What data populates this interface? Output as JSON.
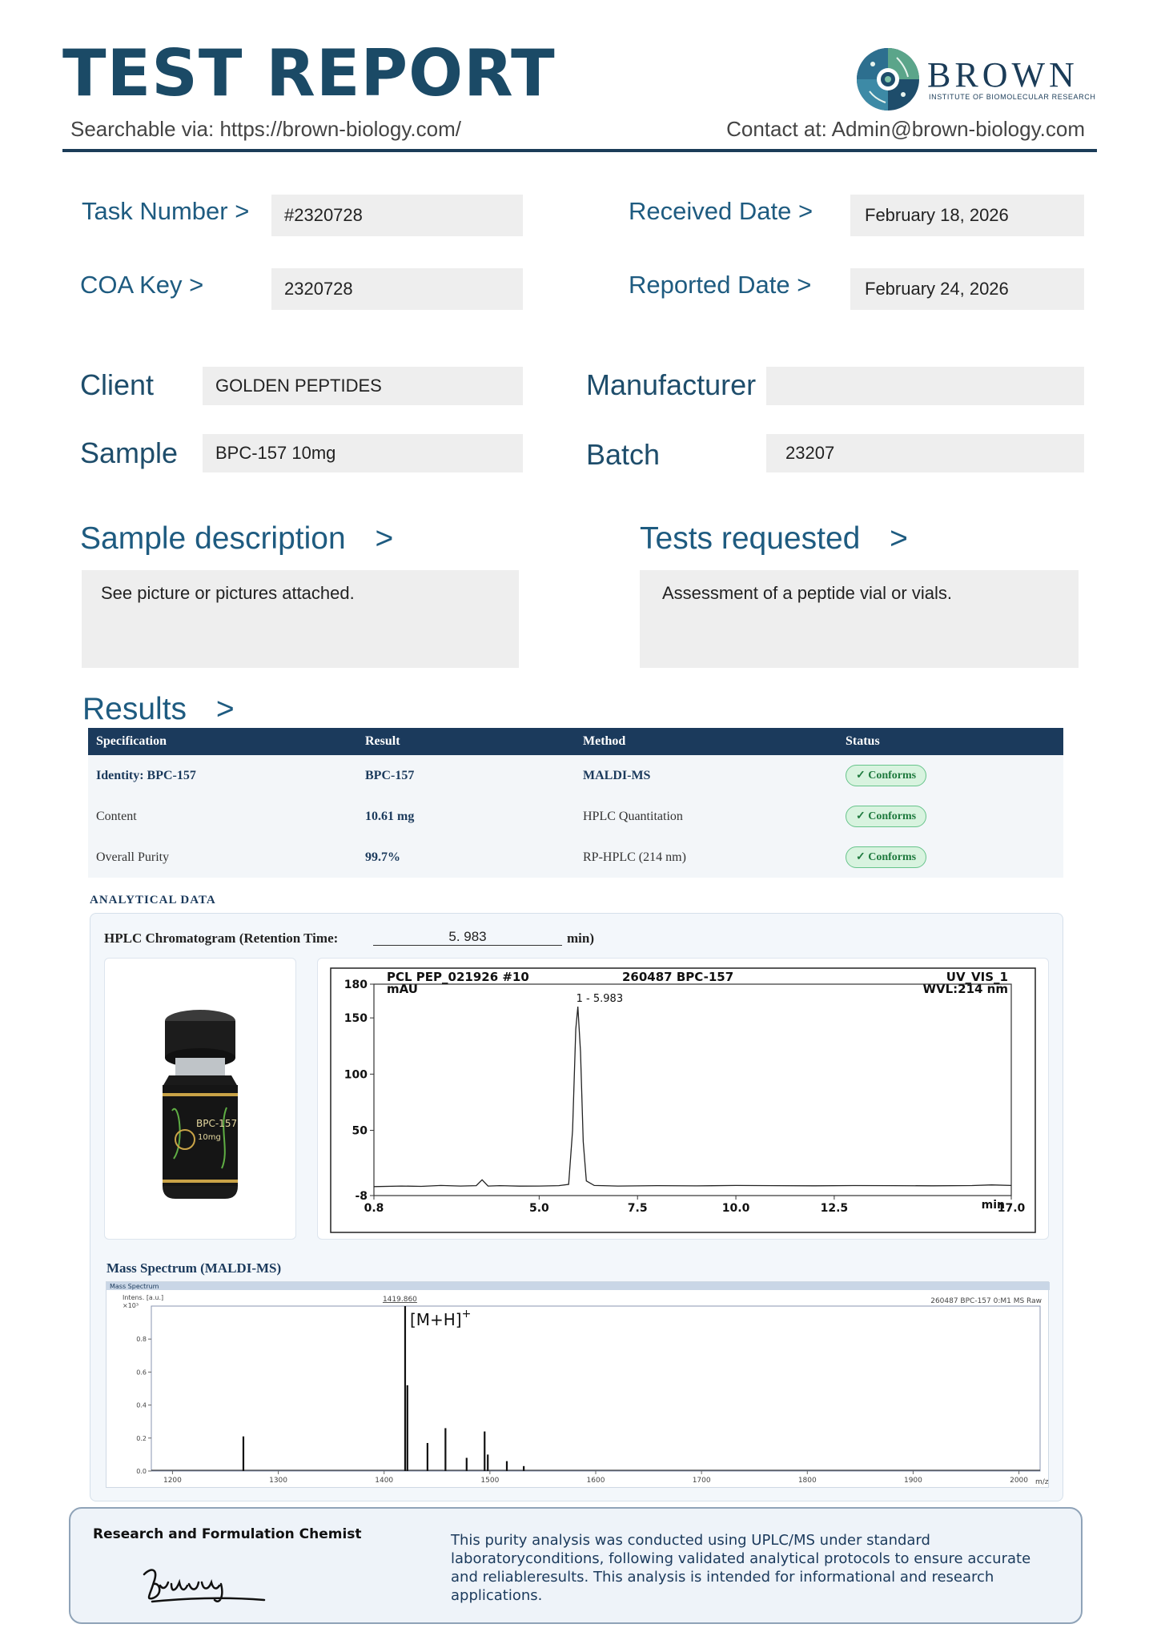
{
  "header": {
    "title": "TEST REPORT",
    "searchable": "Searchable via: https://brown-biology.com/",
    "contact": "Contact at: Admin@brown-biology.com",
    "brand_name": "BROWN",
    "brand_sub": "INSTITUTE OF BIOMOLECULAR RESEARCH"
  },
  "fields": {
    "task_number_label": "Task Number  >",
    "task_number": "#2320728",
    "coa_key_label": "COA  Key >",
    "coa_key": "2320728",
    "received_date_label": "Received Date  >",
    "received_date": "February 18, 2026",
    "reported_date_label": "Reported Date >",
    "reported_date": "February 24, 2026",
    "client_label": "Client",
    "client": "GOLDEN PEPTIDES",
    "manufacturer_label": "Manufacturer",
    "manufacturer": "",
    "sample_label": "Sample",
    "sample": "BPC-157 10mg",
    "batch_label": "Batch",
    "batch": "23207"
  },
  "sample_description": {
    "label": "Sample description",
    "arrow": ">",
    "text": "See picture or pictures attached."
  },
  "tests_requested": {
    "label": "Tests requested",
    "arrow": ">",
    "text": "Assessment of a peptide vial or vials."
  },
  "results": {
    "label": "Results",
    "arrow": ">",
    "columns": [
      "Specification",
      "Result",
      "Method",
      "Status"
    ],
    "rows": [
      {
        "spec": "Identity:  BPC-157",
        "result": "BPC-157",
        "method": "MALDI-MS",
        "status": "✓ Conforms"
      },
      {
        "spec": "Content",
        "result": "10.61   mg",
        "method": "HPLC Quantitation",
        "status": "✓ Conforms"
      },
      {
        "spec": "Overall Purity",
        "result": "99.7%",
        "method": "RP-HPLC (214 nm)",
        "status": "✓ Conforms"
      }
    ]
  },
  "analytical": {
    "label": "ANALYTICAL DATA",
    "hplc_title": "HPLC Chromatogram (Retention Time:",
    "retention_time": "5. 983",
    "rt_unit": "min)",
    "ms_title": "Mass Spectrum (MALDI-MS)"
  },
  "vial": {
    "label_main": "BPC-157",
    "label_dose": "10mg"
  },
  "chart_data": [
    {
      "type": "line",
      "header_left": "PCL PEP_021926 #10",
      "header_mid": "260487 BPC-157",
      "header_right": "UV_VIS_1",
      "header_right2": "WVL:214 nm",
      "ylabel": "mAU",
      "xlabel": "min",
      "xlim": [
        0.8,
        17.0
      ],
      "ylim": [
        -8,
        180
      ],
      "x_ticks": [
        "0.8",
        "5.0",
        "7.5",
        "10.0",
        "12.5",
        "17.0"
      ],
      "x_tick_values": [
        0.8,
        5.0,
        7.5,
        10.0,
        12.5,
        17.0
      ],
      "y_ticks": [
        "180",
        "150",
        "100",
        "50",
        "-8"
      ],
      "y_tick_values": [
        180,
        150,
        100,
        50,
        -8
      ],
      "peak_label": "1 - 5.983",
      "x": [
        0.8,
        1.5,
        2.0,
        2.5,
        3.0,
        3.4,
        3.55,
        3.7,
        4.0,
        4.5,
        5.0,
        5.5,
        5.75,
        5.85,
        5.93,
        5.983,
        6.05,
        6.12,
        6.2,
        6.4,
        7.0,
        8.0,
        9.0,
        10.0,
        11.0,
        12.0,
        13.0,
        14.0,
        15.0,
        16.0,
        16.5,
        17.0
      ],
      "y": [
        0,
        0.5,
        0.2,
        1,
        0.5,
        0.8,
        6,
        0.5,
        0.8,
        0.4,
        0.5,
        0.8,
        2,
        50,
        140,
        160,
        120,
        40,
        5,
        1,
        0.5,
        0.8,
        0.6,
        1,
        0.8,
        0.7,
        0.9,
        0.8,
        0.7,
        0.9,
        1.5,
        1
      ]
    },
    {
      "type": "bar",
      "title_strip": "Mass Spectrum",
      "header_right": "260487 BPC-157 0:M1  MS Raw",
      "ylabel": "Intens. [a.u.]",
      "y_exp": "×10³",
      "xlabel": "m/z",
      "peak_mz_label": "1419.860",
      "peak_label": "[M+H]",
      "peak_sup": "+",
      "xlim": [
        1180,
        2020
      ],
      "ylim": [
        0,
        1.0
      ],
      "x_ticks": [
        "1200",
        "1300",
        "1400",
        "1500",
        "1600",
        "1700",
        "1800",
        "1900",
        "2000"
      ],
      "x_tick_values": [
        1200,
        1300,
        1400,
        1500,
        1600,
        1700,
        1800,
        1900,
        2000
      ],
      "y_ticks": [
        "0.8",
        "0.6",
        "0.4",
        "0.2",
        "0.0"
      ],
      "y_tick_values": [
        0.8,
        0.6,
        0.4,
        0.2,
        0.0
      ],
      "x": [
        1267,
        1419.86,
        1422,
        1441,
        1458,
        1478,
        1495,
        1498,
        1516,
        1532
      ],
      "values": [
        0.21,
        1.0,
        0.52,
        0.17,
        0.26,
        0.08,
        0.24,
        0.1,
        0.06,
        0.03
      ]
    }
  ],
  "footer": {
    "chemist": "Research and Formulation Chemist",
    "signature": "Bisbang",
    "text": "This purity analysis was conducted using UPLC/MS under standard laboratoryconditions, following validated analytical protocols to ensure accurate and reliableresults. This analysis is intended for informational and research applications."
  },
  "colors": {
    "primary": "#1b4a66",
    "table_header": "#1b3a5c",
    "conform_green": "#1f7a3e",
    "box_gray": "#eeeeee"
  }
}
